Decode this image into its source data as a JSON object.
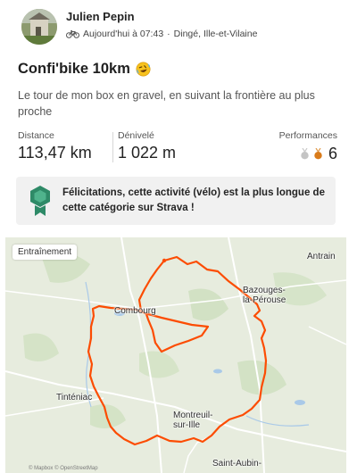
{
  "athlete": {
    "name": "Julien Pepin"
  },
  "activity": {
    "sport_icon": "bike-icon",
    "date": "Aujourd'hui à 07:43",
    "separator": "·",
    "location": "Dingé, Ille-et-Vilaine",
    "title": "Confi'bike 10km",
    "emoji": "rolling-laughing-emoji",
    "description": "Le tour de mon box en gravel, en suivant la frontière au plus proche"
  },
  "stats": {
    "distance": {
      "label": "Distance",
      "value": "113,47 km"
    },
    "elevation": {
      "label": "Dénivelé",
      "value": "1 022 m"
    },
    "performances": {
      "label": "Performances",
      "count": "6"
    }
  },
  "achievement": {
    "icon": "achievement-medal-icon",
    "text": "Félicitations, cette activité (vélo) est la plus longue de cette catégorie sur Strava !"
  },
  "map": {
    "badge": "Entraînement",
    "places": {
      "antrain": "Antrain",
      "bazouges": "Bazouges-\nla-Pérouse",
      "combourg": "Combourg",
      "tinteniac": "Tinténiac",
      "montreuil": "Montreuil-\nsur-Ille",
      "saint_aubin": "Saint-Aubin-"
    },
    "attribution": "© Mapbox  © OpenStreetMap",
    "route_color": "#fc4c02"
  },
  "colors": {
    "accent": "#fc4c02",
    "achievement_green": "#2e8a67",
    "medal_bronze": "#d97b1a",
    "medal_silver": "#b8b8b8"
  }
}
